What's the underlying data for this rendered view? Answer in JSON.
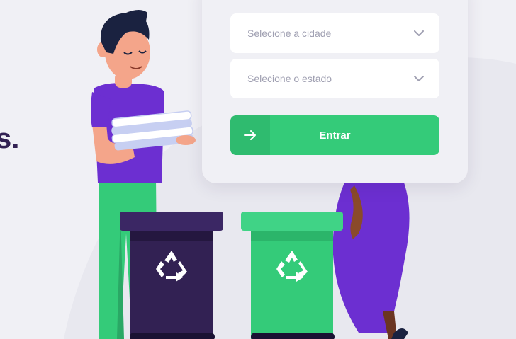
{
  "hero": {
    "text_fragment": "s."
  },
  "form": {
    "city_select": {
      "placeholder": "Selecione a cidade"
    },
    "state_select": {
      "placeholder": "Selecione o estado"
    },
    "submit": {
      "label": "Entrar",
      "icon": "arrow-right-icon"
    }
  },
  "illustration": {
    "description_icons": [
      "recycle-icon",
      "recycle-icon"
    ],
    "colors": {
      "background": "#f0f0f5",
      "brand_green": "#34cb79",
      "dark_purple": "#322153",
      "shirt_purple": "#6c2fd1"
    }
  }
}
